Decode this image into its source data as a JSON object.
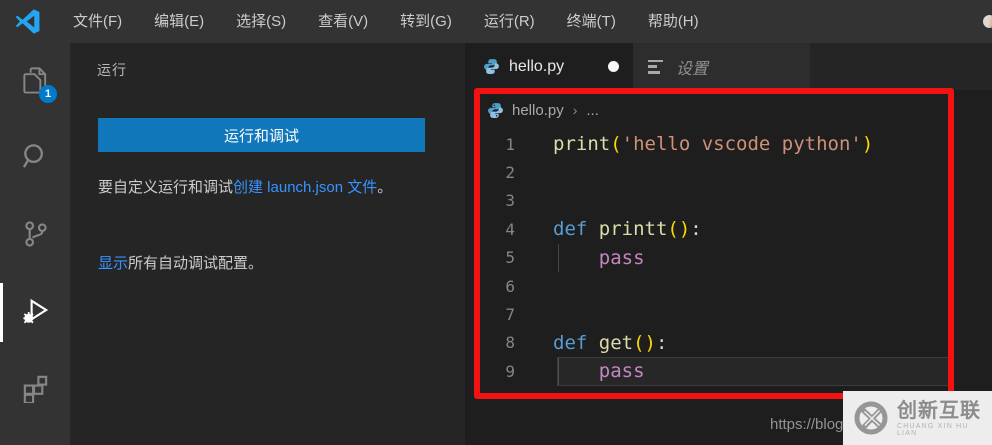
{
  "menu": {
    "items": [
      {
        "name": "file",
        "label": "文件(F)"
      },
      {
        "name": "edit",
        "label": "编辑(E)"
      },
      {
        "name": "selection",
        "label": "选择(S)"
      },
      {
        "name": "view",
        "label": "查看(V)"
      },
      {
        "name": "go",
        "label": "转到(G)"
      },
      {
        "name": "run",
        "label": "运行(R)"
      },
      {
        "name": "terminal",
        "label": "终端(T)"
      },
      {
        "name": "help",
        "label": "帮助(H)"
      }
    ]
  },
  "activity_bar": {
    "items": [
      {
        "name": "explorer",
        "icon": "files-icon",
        "badge": "1",
        "active": false
      },
      {
        "name": "search",
        "icon": "search-icon",
        "active": false
      },
      {
        "name": "source-control",
        "icon": "source-control-icon",
        "active": false
      },
      {
        "name": "run-and-debug",
        "icon": "run-debug-icon",
        "active": true
      },
      {
        "name": "extensions",
        "icon": "extensions-icon",
        "active": false
      }
    ]
  },
  "sidebar": {
    "title": "运行",
    "run_debug_button": "运行和调试",
    "customize_prefix": "要自定义运行和调试",
    "customize_link": "创建 launch.json 文件",
    "customize_suffix": "。",
    "show_link": "显示",
    "show_suffix": "所有自动调试配置。"
  },
  "editor": {
    "tabs": [
      {
        "name": "hello-py",
        "label": "hello.py",
        "icon": "python-icon",
        "modified": true,
        "active": true
      },
      {
        "name": "settings",
        "label": "设置",
        "icon": "settings-icon",
        "modified": false,
        "active": false
      }
    ],
    "breadcrumb": {
      "file": "hello.py",
      "separator": "›",
      "rest": "..."
    },
    "code_lines": [
      {
        "num": "1",
        "tokens": [
          [
            "fn",
            "print"
          ],
          [
            "br",
            "("
          ],
          [
            "str",
            "'hello vscode python'"
          ],
          [
            "br",
            ")"
          ]
        ],
        "guide": false,
        "current": false
      },
      {
        "num": "2",
        "tokens": [],
        "guide": false,
        "current": false
      },
      {
        "num": "3",
        "tokens": [],
        "guide": false,
        "current": false
      },
      {
        "num": "4",
        "tokens": [
          [
            "kw",
            "def "
          ],
          [
            "fn",
            "printt"
          ],
          [
            "br",
            "()"
          ],
          [
            "pn",
            ":"
          ]
        ],
        "guide": false,
        "current": false
      },
      {
        "num": "5",
        "tokens": [
          [
            "pl",
            "    "
          ],
          [
            "ctl",
            "pass"
          ]
        ],
        "guide": true,
        "current": false
      },
      {
        "num": "6",
        "tokens": [],
        "guide": false,
        "current": false
      },
      {
        "num": "7",
        "tokens": [],
        "guide": false,
        "current": false
      },
      {
        "num": "8",
        "tokens": [
          [
            "kw",
            "def "
          ],
          [
            "fn",
            "get"
          ],
          [
            "br",
            "()"
          ],
          [
            "pn",
            ":"
          ]
        ],
        "guide": false,
        "current": false
      },
      {
        "num": "9",
        "tokens": [
          [
            "pl",
            "    "
          ],
          [
            "ctl",
            "pass"
          ]
        ],
        "guide": true,
        "current": true
      }
    ]
  },
  "watermark": {
    "url_text": "https://blog",
    "brand": "创新互联",
    "brand_sub": "CHUANG XIN HU LIAN"
  },
  "colors": {
    "accent": "#007acc",
    "button_blue": "#1177bb",
    "link_blue": "#3794ff",
    "annotation_red": "#f21212",
    "token_keyword": "#569cd6",
    "token_function": "#dcdcaa",
    "token_string": "#ce9178",
    "token_bracket": "#ffd700",
    "token_control": "#c586c0"
  }
}
